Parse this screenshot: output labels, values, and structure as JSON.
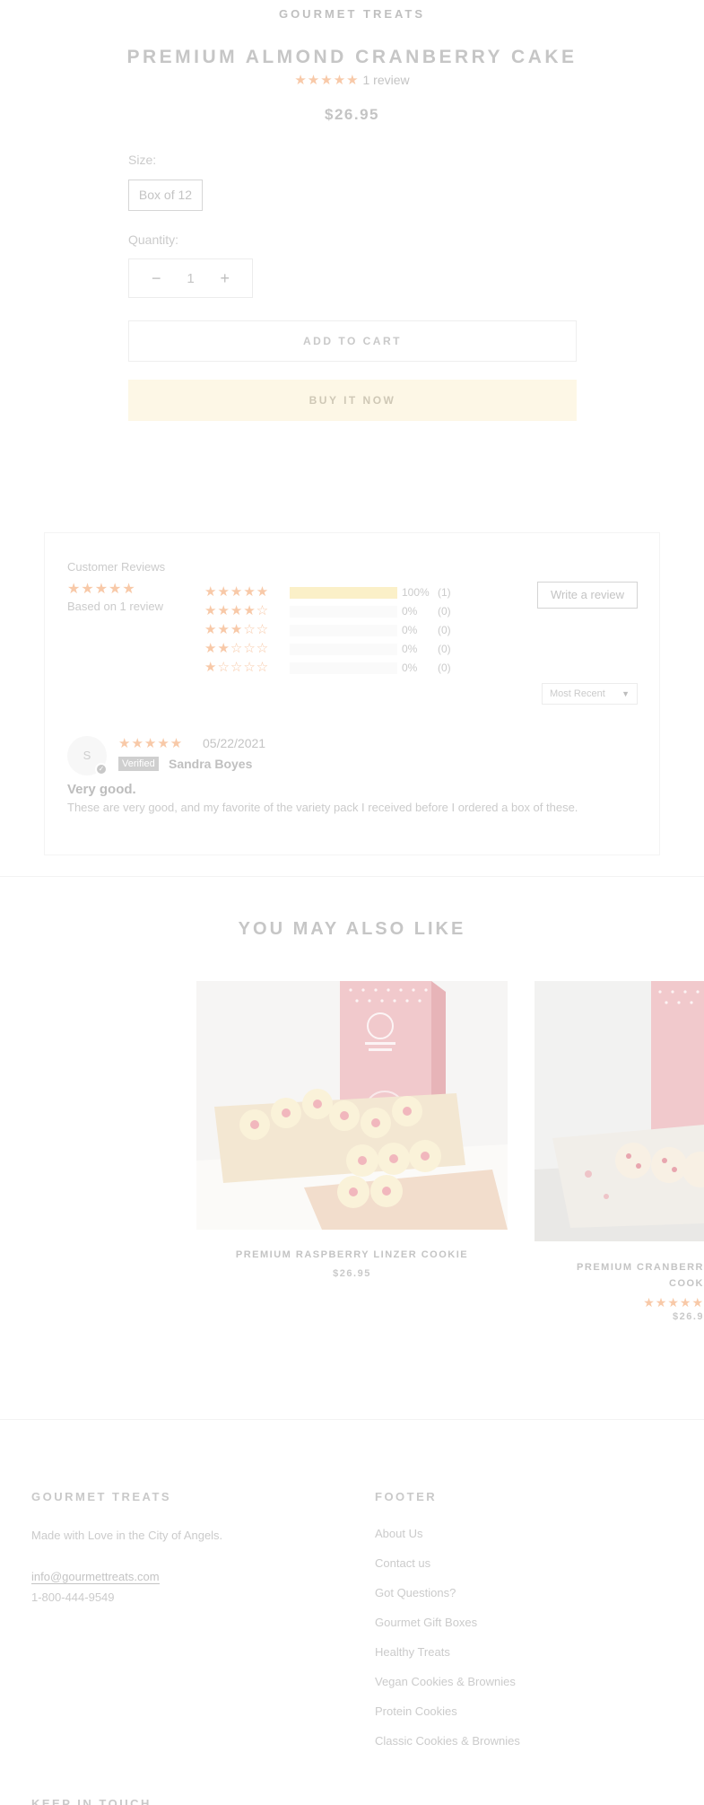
{
  "product": {
    "vendor": "GOURMET TREATS",
    "title": "PREMIUM ALMOND CRANBERRY CAKE",
    "rating_stars": "★★★★★",
    "rating": 5,
    "review_count_label": "1 review",
    "price": "$26.95",
    "size_label": "Size:",
    "size_value": "Box of 12",
    "quantity_label": "Quantity:",
    "quantity_value": "1",
    "minus_symbol": "−",
    "plus_symbol": "+",
    "add_to_cart": "ADD TO CART",
    "buy_it_now": "BUY IT NOW"
  },
  "reviews": {
    "title": "Customer Reviews",
    "summary_stars": "★★★★★",
    "average": 5,
    "based_on": "Based on 1 review",
    "histogram": [
      {
        "stars": "★★★★★",
        "percent_label": "100%",
        "count_label": "(1)",
        "fraction": 1.0
      },
      {
        "stars": "★★★★☆",
        "percent_label": "0%",
        "count_label": "(0)",
        "fraction": 0.0
      },
      {
        "stars": "★★★☆☆",
        "percent_label": "0%",
        "count_label": "(0)",
        "fraction": 0.0
      },
      {
        "stars": "★★☆☆☆",
        "percent_label": "0%",
        "count_label": "(0)",
        "fraction": 0.0
      },
      {
        "stars": "★☆☆☆☆",
        "percent_label": "0%",
        "count_label": "(0)",
        "fraction": 0.0
      }
    ],
    "write_review": "Write a review",
    "sort_value": "Most Recent",
    "sort_caret": "▼",
    "items": [
      {
        "avatar_letter": "S",
        "avatar_check": "✓",
        "stars": "★★★★★",
        "date": "05/22/2021",
        "verified": "Verified",
        "author": "Sandra Boyes",
        "headline": "Very good.",
        "body": "These are very good, and my favorite of the variety pack I received before I ordered a box of these."
      }
    ]
  },
  "recommendations": {
    "heading": "YOU MAY ALSO LIKE",
    "items": [
      {
        "name": "PREMIUM RASPBERRY LINZER COOKIE",
        "price": "$26.95",
        "stars": ""
      },
      {
        "name_line1": "PREMIUM CRANBERR",
        "name_line2": "COOK",
        "price": "$26.9",
        "stars": "★★★★★"
      }
    ]
  },
  "footer": {
    "brand_heading": "GOURMET TREATS",
    "tagline": "Made with Love in the City of Angels.",
    "email": "info@gourmettreats.com",
    "phone": "1-800-444-9549",
    "links_heading": "FOOTER",
    "links": [
      "About Us",
      "Contact us",
      "Got Questions?",
      "Gourmet Gift Boxes",
      "Healthy Treats",
      "Vegan Cookies & Brownies",
      "Protein Cookies",
      "Classic Cookies & Brownies"
    ],
    "keep_in_touch_heading": "KEEP IN TOUCH"
  },
  "colors": {
    "star": "#f8c9a8",
    "buy_now_bg": "#fdf7e6",
    "histogram_fill": "#fbf0c8"
  }
}
